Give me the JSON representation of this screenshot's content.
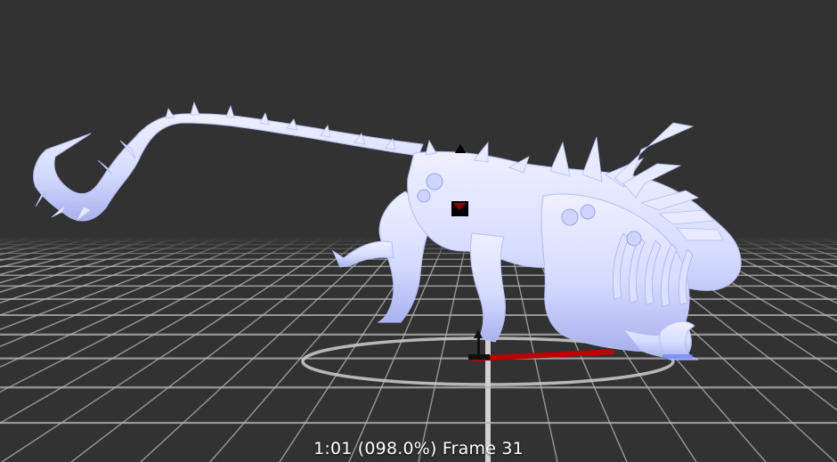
{
  "viewport": {
    "background_color": "#323232",
    "grid_color": "#b9b9b9",
    "grid_center_color": "#e2e2e2",
    "model_color": "#d6dcff",
    "model_shade_color": "#9aa3e6",
    "bone_marker_color": "#8e0000",
    "root_track_color": "#c00000"
  },
  "status": {
    "timecode": "1:01 (098.0%) Frame 31"
  }
}
